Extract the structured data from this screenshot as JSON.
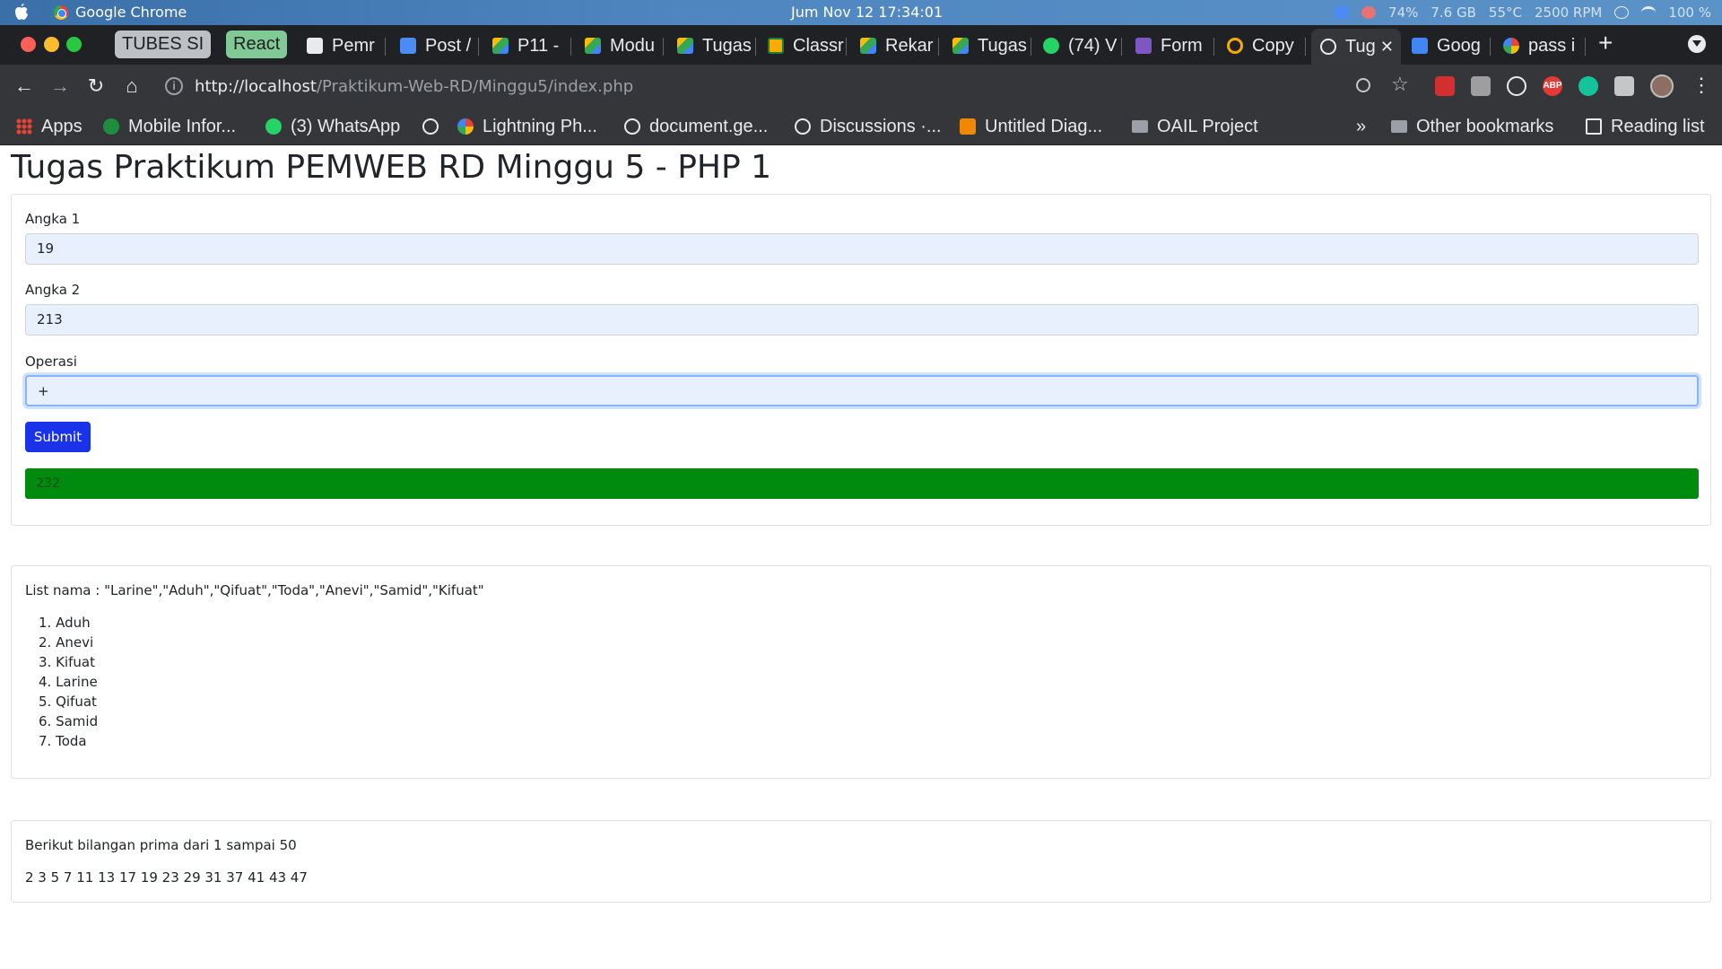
{
  "os": {
    "app_name": "Google Chrome",
    "clock": "Jum Nov 12  17:34:01",
    "battery": "74%",
    "memory": "7.6 GB",
    "temperature": "55°C",
    "fan": "2500 RPM",
    "volume": "100 %"
  },
  "tab_groups": [
    {
      "label": "TUBES SI",
      "color": "#bdc1c6"
    },
    {
      "label": "React",
      "color": "#81c995"
    }
  ],
  "tabs": [
    {
      "label": "Pemr",
      "icon": "document-icon",
      "icon_color": "#e8eaed"
    },
    {
      "label": "Post /",
      "icon": "video-icon",
      "icon_color": "#4c8bf5"
    },
    {
      "label": "P11 -",
      "icon": "drive-icon",
      "icon_color": "#fbbc05"
    },
    {
      "label": "Modu",
      "icon": "drive-icon",
      "icon_color": "#fbbc05"
    },
    {
      "label": "Tugas",
      "icon": "drive-icon",
      "icon_color": "#fbbc05"
    },
    {
      "label": "Classr",
      "icon": "classroom-icon",
      "icon_color": "#f9ab00"
    },
    {
      "label": "Rekar",
      "icon": "drive-icon",
      "icon_color": "#fbbc05"
    },
    {
      "label": "Tugas",
      "icon": "drive-icon",
      "icon_color": "#fbbc05"
    },
    {
      "label": "(74) V",
      "icon": "whatsapp-icon",
      "icon_color": "#25d366"
    },
    {
      "label": "Form",
      "icon": "forms-icon",
      "icon_color": "#7e57c2"
    },
    {
      "label": "Copy",
      "icon": "colab-icon",
      "icon_color": "#f9ab00"
    },
    {
      "label": "Tug",
      "icon": "globe-icon",
      "icon_color": "#e8eaed"
    },
    {
      "label": "Goog",
      "icon": "docs-icon",
      "icon_color": "#4285f4"
    },
    {
      "label": "pass i",
      "icon": "google-icon",
      "icon_color": "#ffffff"
    }
  ],
  "toolbar": {
    "url_host": "http://localhost",
    "url_path": "/Praktikum-Web-RD/Minggu5/index.php",
    "extensions": [
      {
        "name": "mendeley-icon",
        "color": "#d32f2f",
        "text": ""
      },
      {
        "name": "extension-icon",
        "color": "#9e9e9e",
        "text": ""
      },
      {
        "name": "react-devtools-icon",
        "color": "#61dafb",
        "text": ""
      },
      {
        "name": "adblock-icon",
        "color": "#e53935",
        "text": "ABP"
      },
      {
        "name": "grammarly-icon",
        "color": "#15c39a",
        "text": ""
      },
      {
        "name": "puzzle-icon",
        "color": "#c4c7c5",
        "text": ""
      }
    ]
  },
  "bookmarks": [
    {
      "label": "Apps",
      "icon": "apps-grid-icon"
    },
    {
      "label": "Mobile Infor...",
      "icon": "bookmark-icon"
    },
    {
      "label": "(3) WhatsApp",
      "icon": "whatsapp-icon"
    },
    {
      "label": "",
      "icon": "globe-icon"
    },
    {
      "label": "Lightning Ph...",
      "icon": "google-icon"
    },
    {
      "label": "document.ge...",
      "icon": "globe-icon"
    },
    {
      "label": "Discussions ·...",
      "icon": "globe-icon"
    },
    {
      "label": "Untitled Diag...",
      "icon": "drawio-icon"
    },
    {
      "label": "OAIL Project",
      "icon": "folder-icon"
    }
  ],
  "bookmarks_overflow": "»",
  "other_bookmarks": "Other bookmarks",
  "reading_list": "Reading list",
  "page": {
    "title": "Tugas Praktikum PEMWEB RD Minggu 5 - PHP 1",
    "form": {
      "angka1_label": "Angka 1",
      "angka1_value": "19",
      "angka2_label": "Angka 2",
      "angka2_value": "213",
      "operasi_label": "Operasi",
      "operasi_value": "+",
      "submit_label": "Submit",
      "result": "232"
    },
    "names": {
      "heading": "List nama : \"Larine\",\"Aduh\",\"Qifuat\",\"Toda\",\"Anevi\",\"Samid\",\"Kifuat\"",
      "sorted": [
        "1. Aduh",
        "2. Anevi",
        "3. Kifuat",
        "4. Larine",
        "5. Qifuat",
        "6. Samid",
        "7. Toda"
      ]
    },
    "primes": {
      "heading": "Berikut bilangan prima dari 1 sampai 50",
      "values": "2 3 5 7 11 13 17 19 23 29 31 37 41 43 47"
    }
  }
}
